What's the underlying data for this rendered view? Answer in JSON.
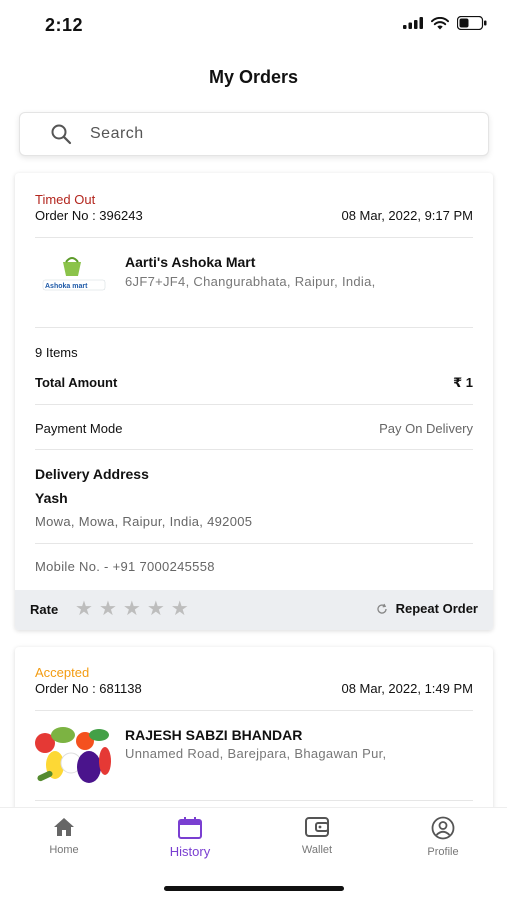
{
  "status_bar": {
    "time": "2:12"
  },
  "header": {
    "title": "My Orders"
  },
  "search": {
    "placeholder": "Search"
  },
  "orders": [
    {
      "status": "Timed Out",
      "status_color": "#b3261e",
      "order_no": "Order No : 396243",
      "date": "08 Mar, 2022,  9:17 PM",
      "store_name": "Aarti's Ashoka Mart",
      "store_address": "6JF7+JF4, Changurabhata, Raipur, India,",
      "logo_text": "Ashoka mart",
      "items": "9 Items",
      "total_label": "Total Amount",
      "total_value": "₹ 1",
      "payment_label": "Payment Mode",
      "payment_value": "Pay On Delivery",
      "delivery_label": "Delivery Address",
      "delivery_name": "Yash",
      "delivery_address": "Mowa, Mowa, Raipur, India, 492005",
      "mobile": "Mobile No. - +91 7000245558",
      "rate_label": "Rate",
      "repeat_label": "Repeat Order"
    },
    {
      "status": "Accepted",
      "status_color": "#f39c12",
      "order_no": "Order No : 681138",
      "date": "08 Mar, 2022,  1:49 PM",
      "store_name": "RAJESH SABZI BHANDAR",
      "store_address": "Unnamed Road, Barejpara, Bhagawan Pur,"
    }
  ],
  "nav": {
    "home": "Home",
    "history": "History",
    "wallet": "Wallet",
    "profile": "Profile"
  },
  "colors": {
    "accent": "#7a3fd1"
  }
}
